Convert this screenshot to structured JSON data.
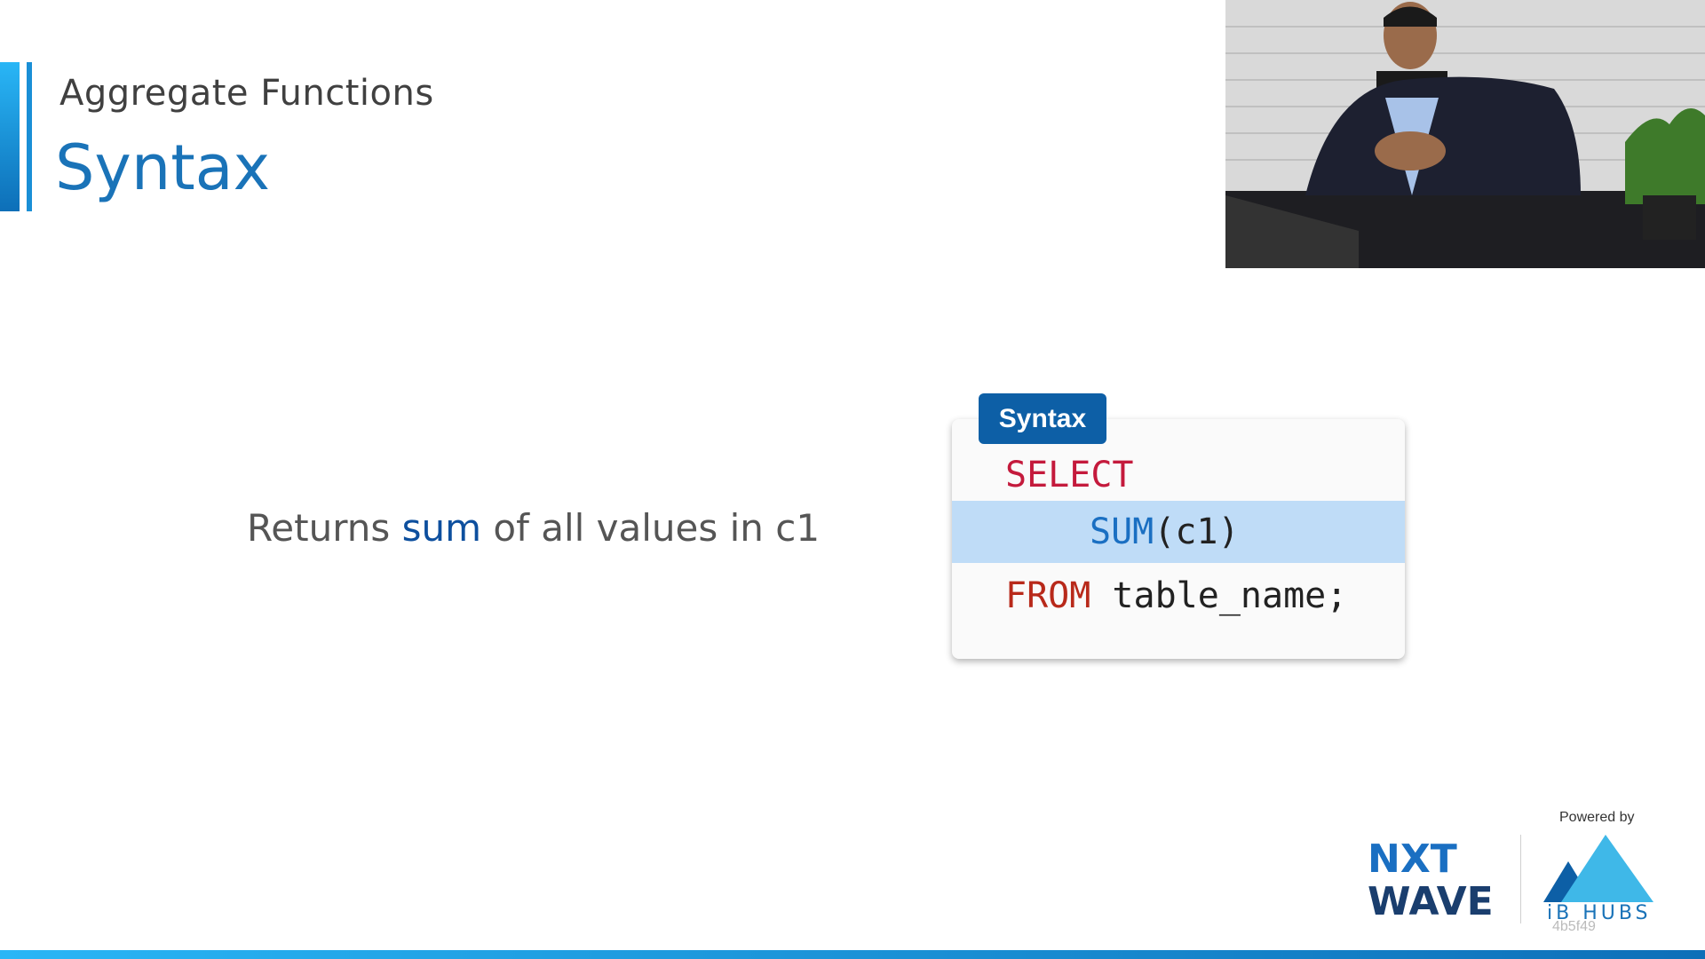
{
  "header": {
    "subtitle": "Aggregate Functions",
    "title": "Syntax"
  },
  "description": {
    "prefix": "Returns ",
    "highlight": "sum",
    "suffix": " of all values in c1"
  },
  "code": {
    "tab_label": "Syntax",
    "line1": "SELECT",
    "line2_fn": "SUM",
    "line2_rest": "(c1)",
    "line3_kw": "FROM",
    "line3_rest": " table_name;"
  },
  "footer": {
    "powered_by": "Powered by",
    "nxt_top": "NXT",
    "nxt_bottom": "WAVE",
    "ib_hubs": "iB HUBS",
    "code": "4b5f49"
  },
  "colors": {
    "accent": "#1a73b8",
    "highlight": "#bfdcf7",
    "keyword": "#c41a3c"
  }
}
